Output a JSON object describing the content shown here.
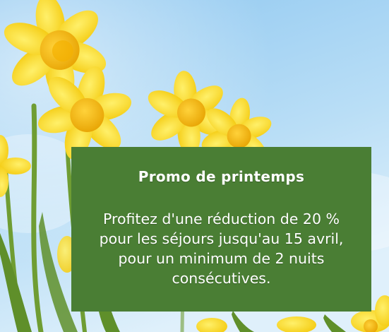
{
  "colors": {
    "sky_top": "#9fd1f3",
    "sky_bottom": "#d6ecfa",
    "petal": "#f7d51a",
    "trumpet": "#f0b400",
    "stem": "#6a9a2e",
    "banner": "#4a7e34",
    "text": "#ffffff"
  },
  "promo": {
    "title": "Promo de printemps",
    "line1": "Profitez d'une réduction de 20 %",
    "line2": "pour les séjours jusqu'au 15 avril,",
    "line3": "pour un minimum de 2 nuits",
    "line4": "consécutives."
  },
  "icons": [
    "daffodil-flower-icon"
  ]
}
